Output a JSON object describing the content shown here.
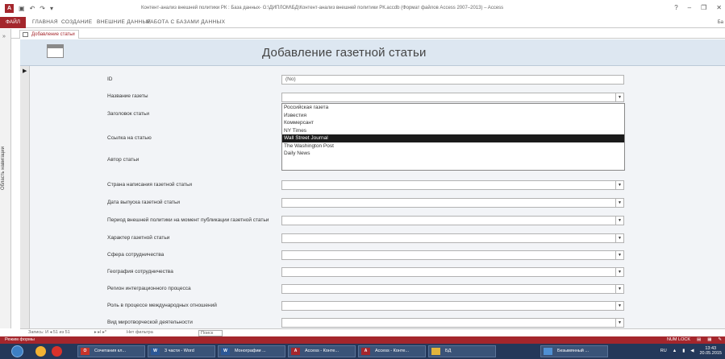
{
  "window": {
    "title": "Контент-анализ внешней политики РК : База данных- G:\\ДИПЛОМ\\БД\\Контент-анализ внешней политики РК.accdb (Формат файлов Access 2007–2013) – Access",
    "help": "?",
    "minimize": "–",
    "restore": "❐",
    "close": "✕"
  },
  "ribbon": {
    "file": "ФАЙЛ",
    "tabs": [
      "ГЛАВНАЯ",
      "СОЗДАНИЕ",
      "ВНЕШНИЕ ДАННЫЕ",
      "РАБОТА С БАЗАМИ ДАННЫХ"
    ],
    "signin": "Бa"
  },
  "nav_pane": {
    "label": "Область навигации"
  },
  "document_tab": {
    "label": "Добавление статьи"
  },
  "form": {
    "title": "Добавление газетной статьи",
    "fields": {
      "id": {
        "label": "ID",
        "value": "(No)"
      },
      "newspaper": {
        "label": "Название газеты",
        "value": ""
      },
      "headline": {
        "label": "Заголовок статьи"
      },
      "link": {
        "label": "Ссылка на статью"
      },
      "author": {
        "label": "Автор статьи"
      },
      "country": {
        "label": "Страна написания газетной статьи"
      },
      "date": {
        "label": "Дата выпуска газетной статьи"
      },
      "period": {
        "label": "Период внешней политики на момент публикации газетной статьи"
      },
      "character": {
        "label": "Характер газетной статьи"
      },
      "sphere": {
        "label": "Сфера сотрудничества"
      },
      "geography": {
        "label": "География сотрудничества"
      },
      "region": {
        "label": "Регион интеграционного процесса"
      },
      "role": {
        "label": "Роль в процессе международных отношений"
      },
      "peace": {
        "label": "Вид миротворческой деятельности"
      }
    },
    "dropdown_options": [
      "Российская газета",
      "Известия",
      "Коммерсант",
      "NY Times",
      "Wall Street Journal",
      "The Washington Post",
      "Daily News"
    ],
    "dropdown_selected": "Wall Street Journal"
  },
  "record_nav": {
    "record": "Запись: И ◂ 51 из 51",
    "next": "▸ ▸I ▸*",
    "filter": "Нет фильтра",
    "search": "Поиск"
  },
  "statusbar": {
    "mode": "Режим формы",
    "numlock": "NUM LOCK"
  },
  "taskbar": {
    "buttons": [
      {
        "label": "Сочетания кл...",
        "icon": "opera-icon",
        "color": "#c8342a",
        "badge": "O"
      },
      {
        "label": "3 части - Word",
        "icon": "word-icon",
        "color": "#2b5797",
        "badge": "W"
      },
      {
        "label": "Монографии ...",
        "icon": "word-icon",
        "color": "#2b5797",
        "badge": "W"
      },
      {
        "label": "Access - Конте...",
        "icon": "access-icon",
        "color": "#a4262c",
        "badge": "A"
      },
      {
        "label": "Access - Конте...",
        "icon": "access-icon",
        "color": "#a4262c",
        "badge": "A"
      },
      {
        "label": "БД",
        "icon": "folder-icon",
        "color": "#e2b43c",
        "badge": ""
      },
      {
        "label": "Безымянный ...",
        "icon": "paint-icon",
        "color": "#4f8fd3",
        "badge": ""
      }
    ],
    "lang": "RU",
    "time": "13:43",
    "date": "20.05.2015"
  },
  "colors": {
    "brand": "#a4262c",
    "form_header": "#dde7f1",
    "taskbar": "#24385a"
  }
}
